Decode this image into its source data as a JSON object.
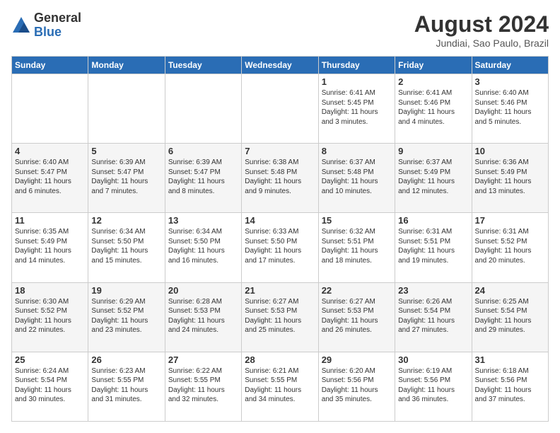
{
  "header": {
    "logo_general": "General",
    "logo_blue": "Blue",
    "month_year": "August 2024",
    "location": "Jundiai, Sao Paulo, Brazil"
  },
  "days_of_week": [
    "Sunday",
    "Monday",
    "Tuesday",
    "Wednesday",
    "Thursday",
    "Friday",
    "Saturday"
  ],
  "weeks": [
    [
      {
        "day": "",
        "info": ""
      },
      {
        "day": "",
        "info": ""
      },
      {
        "day": "",
        "info": ""
      },
      {
        "day": "",
        "info": ""
      },
      {
        "day": "1",
        "info": "Sunrise: 6:41 AM\nSunset: 5:45 PM\nDaylight: 11 hours\nand 3 minutes."
      },
      {
        "day": "2",
        "info": "Sunrise: 6:41 AM\nSunset: 5:46 PM\nDaylight: 11 hours\nand 4 minutes."
      },
      {
        "day": "3",
        "info": "Sunrise: 6:40 AM\nSunset: 5:46 PM\nDaylight: 11 hours\nand 5 minutes."
      }
    ],
    [
      {
        "day": "4",
        "info": "Sunrise: 6:40 AM\nSunset: 5:47 PM\nDaylight: 11 hours\nand 6 minutes."
      },
      {
        "day": "5",
        "info": "Sunrise: 6:39 AM\nSunset: 5:47 PM\nDaylight: 11 hours\nand 7 minutes."
      },
      {
        "day": "6",
        "info": "Sunrise: 6:39 AM\nSunset: 5:47 PM\nDaylight: 11 hours\nand 8 minutes."
      },
      {
        "day": "7",
        "info": "Sunrise: 6:38 AM\nSunset: 5:48 PM\nDaylight: 11 hours\nand 9 minutes."
      },
      {
        "day": "8",
        "info": "Sunrise: 6:37 AM\nSunset: 5:48 PM\nDaylight: 11 hours\nand 10 minutes."
      },
      {
        "day": "9",
        "info": "Sunrise: 6:37 AM\nSunset: 5:49 PM\nDaylight: 11 hours\nand 12 minutes."
      },
      {
        "day": "10",
        "info": "Sunrise: 6:36 AM\nSunset: 5:49 PM\nDaylight: 11 hours\nand 13 minutes."
      }
    ],
    [
      {
        "day": "11",
        "info": "Sunrise: 6:35 AM\nSunset: 5:49 PM\nDaylight: 11 hours\nand 14 minutes."
      },
      {
        "day": "12",
        "info": "Sunrise: 6:34 AM\nSunset: 5:50 PM\nDaylight: 11 hours\nand 15 minutes."
      },
      {
        "day": "13",
        "info": "Sunrise: 6:34 AM\nSunset: 5:50 PM\nDaylight: 11 hours\nand 16 minutes."
      },
      {
        "day": "14",
        "info": "Sunrise: 6:33 AM\nSunset: 5:50 PM\nDaylight: 11 hours\nand 17 minutes."
      },
      {
        "day": "15",
        "info": "Sunrise: 6:32 AM\nSunset: 5:51 PM\nDaylight: 11 hours\nand 18 minutes."
      },
      {
        "day": "16",
        "info": "Sunrise: 6:31 AM\nSunset: 5:51 PM\nDaylight: 11 hours\nand 19 minutes."
      },
      {
        "day": "17",
        "info": "Sunrise: 6:31 AM\nSunset: 5:52 PM\nDaylight: 11 hours\nand 20 minutes."
      }
    ],
    [
      {
        "day": "18",
        "info": "Sunrise: 6:30 AM\nSunset: 5:52 PM\nDaylight: 11 hours\nand 22 minutes."
      },
      {
        "day": "19",
        "info": "Sunrise: 6:29 AM\nSunset: 5:52 PM\nDaylight: 11 hours\nand 23 minutes."
      },
      {
        "day": "20",
        "info": "Sunrise: 6:28 AM\nSunset: 5:53 PM\nDaylight: 11 hours\nand 24 minutes."
      },
      {
        "day": "21",
        "info": "Sunrise: 6:27 AM\nSunset: 5:53 PM\nDaylight: 11 hours\nand 25 minutes."
      },
      {
        "day": "22",
        "info": "Sunrise: 6:27 AM\nSunset: 5:53 PM\nDaylight: 11 hours\nand 26 minutes."
      },
      {
        "day": "23",
        "info": "Sunrise: 6:26 AM\nSunset: 5:54 PM\nDaylight: 11 hours\nand 27 minutes."
      },
      {
        "day": "24",
        "info": "Sunrise: 6:25 AM\nSunset: 5:54 PM\nDaylight: 11 hours\nand 29 minutes."
      }
    ],
    [
      {
        "day": "25",
        "info": "Sunrise: 6:24 AM\nSunset: 5:54 PM\nDaylight: 11 hours\nand 30 minutes."
      },
      {
        "day": "26",
        "info": "Sunrise: 6:23 AM\nSunset: 5:55 PM\nDaylight: 11 hours\nand 31 minutes."
      },
      {
        "day": "27",
        "info": "Sunrise: 6:22 AM\nSunset: 5:55 PM\nDaylight: 11 hours\nand 32 minutes."
      },
      {
        "day": "28",
        "info": "Sunrise: 6:21 AM\nSunset: 5:55 PM\nDaylight: 11 hours\nand 34 minutes."
      },
      {
        "day": "29",
        "info": "Sunrise: 6:20 AM\nSunset: 5:56 PM\nDaylight: 11 hours\nand 35 minutes."
      },
      {
        "day": "30",
        "info": "Sunrise: 6:19 AM\nSunset: 5:56 PM\nDaylight: 11 hours\nand 36 minutes."
      },
      {
        "day": "31",
        "info": "Sunrise: 6:18 AM\nSunset: 5:56 PM\nDaylight: 11 hours\nand 37 minutes."
      }
    ]
  ]
}
